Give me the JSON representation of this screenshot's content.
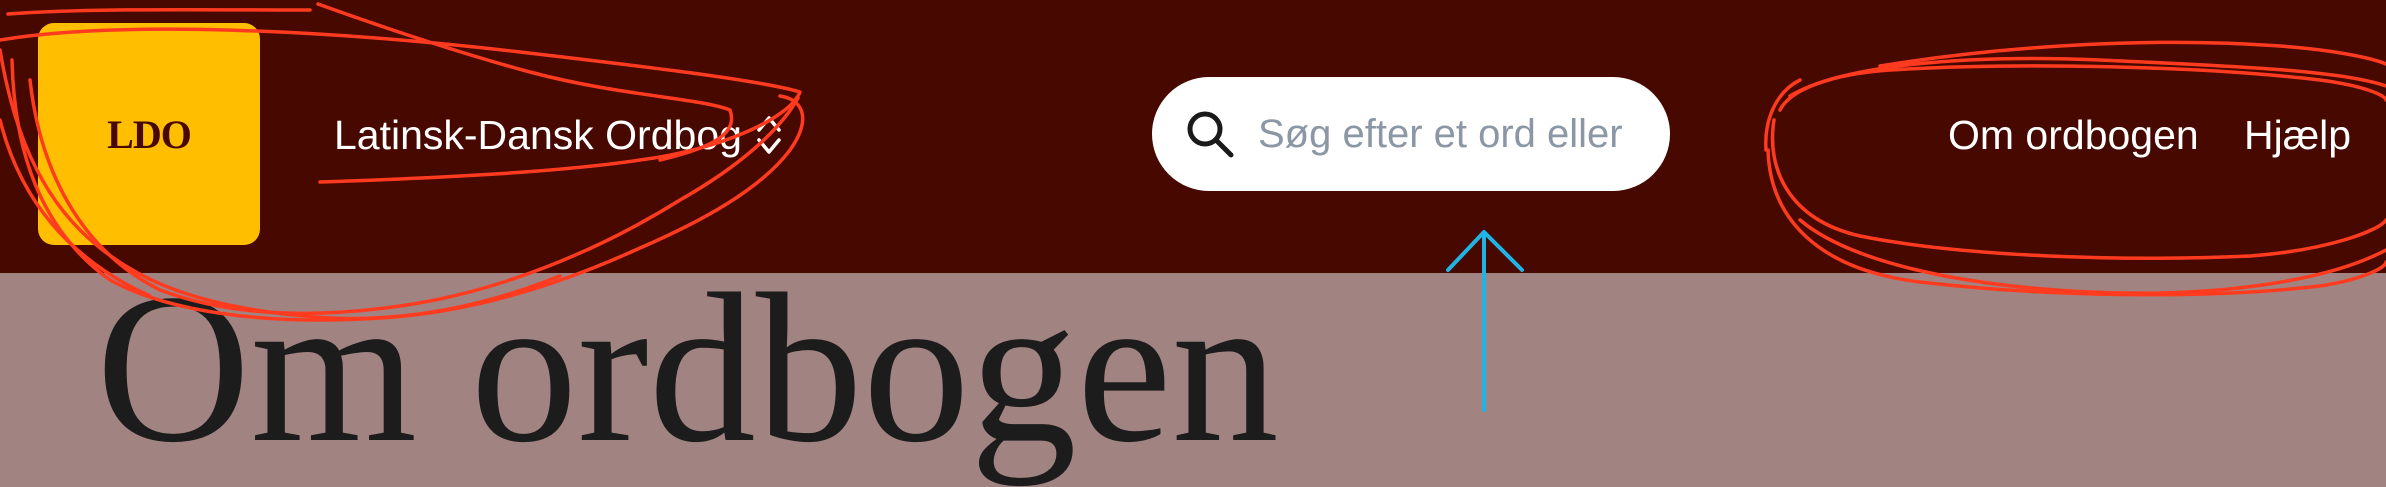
{
  "header": {
    "logo_text": "LDO",
    "dictionary_selector_label": "Latinsk-Dansk Ordbog",
    "search": {
      "placeholder": "Søg efter et ord eller",
      "value": ""
    },
    "nav": {
      "about_label": "Om ordbogen",
      "help_label": "Hjælp"
    }
  },
  "main": {
    "page_title": "Om ordbogen"
  },
  "colors": {
    "header_bg": "#470800",
    "logo_bg": "#ffbe00",
    "page_bg": "#a18481",
    "annotation_red": "#ff3b1f",
    "annotation_blue": "#20b4e6"
  },
  "icons": {
    "search": "search-icon",
    "selector": "chevron-up-down-icon",
    "annotation_arrow": "arrow-up-icon"
  }
}
